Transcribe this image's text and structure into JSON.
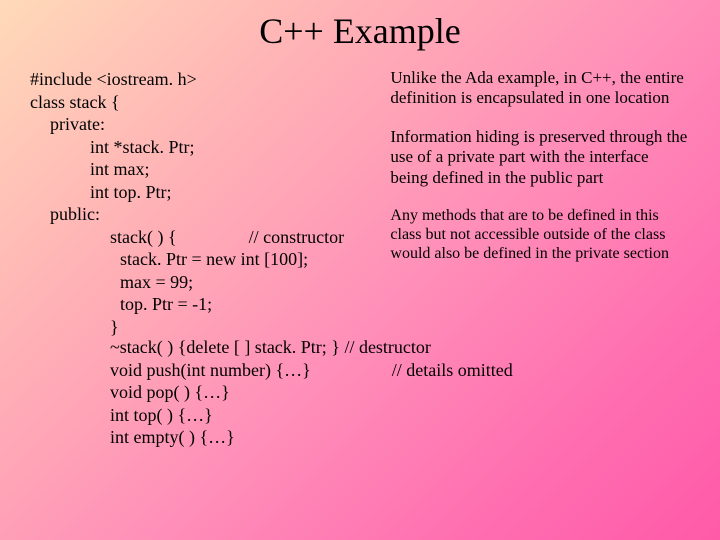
{
  "title": "C++ Example",
  "code": {
    "l1": "#include <iostream. h>",
    "l2": "class stack {",
    "l3": "private:",
    "l4": "int *stack. Ptr;",
    "l5": "int max;",
    "l6": "int top. Ptr;",
    "l7": "public:",
    "l8a": "stack( ) {",
    "l8b": "// constructor",
    "l9": "stack. Ptr = new int [100];",
    "l10": "max = 99;",
    "l11": "top. Ptr = -1;",
    "l12": "}",
    "l13": "~stack( ) {delete [ ] stack. Ptr; } // destructor",
    "l14a": "void push(int number) {…}",
    "l14b": "// details omitted",
    "l15": "void pop( ) {…}",
    "l16": "int top( ) {…}",
    "l17": "int empty( ) {…}"
  },
  "notes": {
    "n1": "Unlike the Ada example, in C++, the entire definition is encapsulated in one location",
    "n2": "Information hiding is preserved through the use of a private part with the interface being defined in the public part",
    "n3": "Any methods that are to be defined in this class but not accessible outside of the class would also be defined in the private section"
  }
}
